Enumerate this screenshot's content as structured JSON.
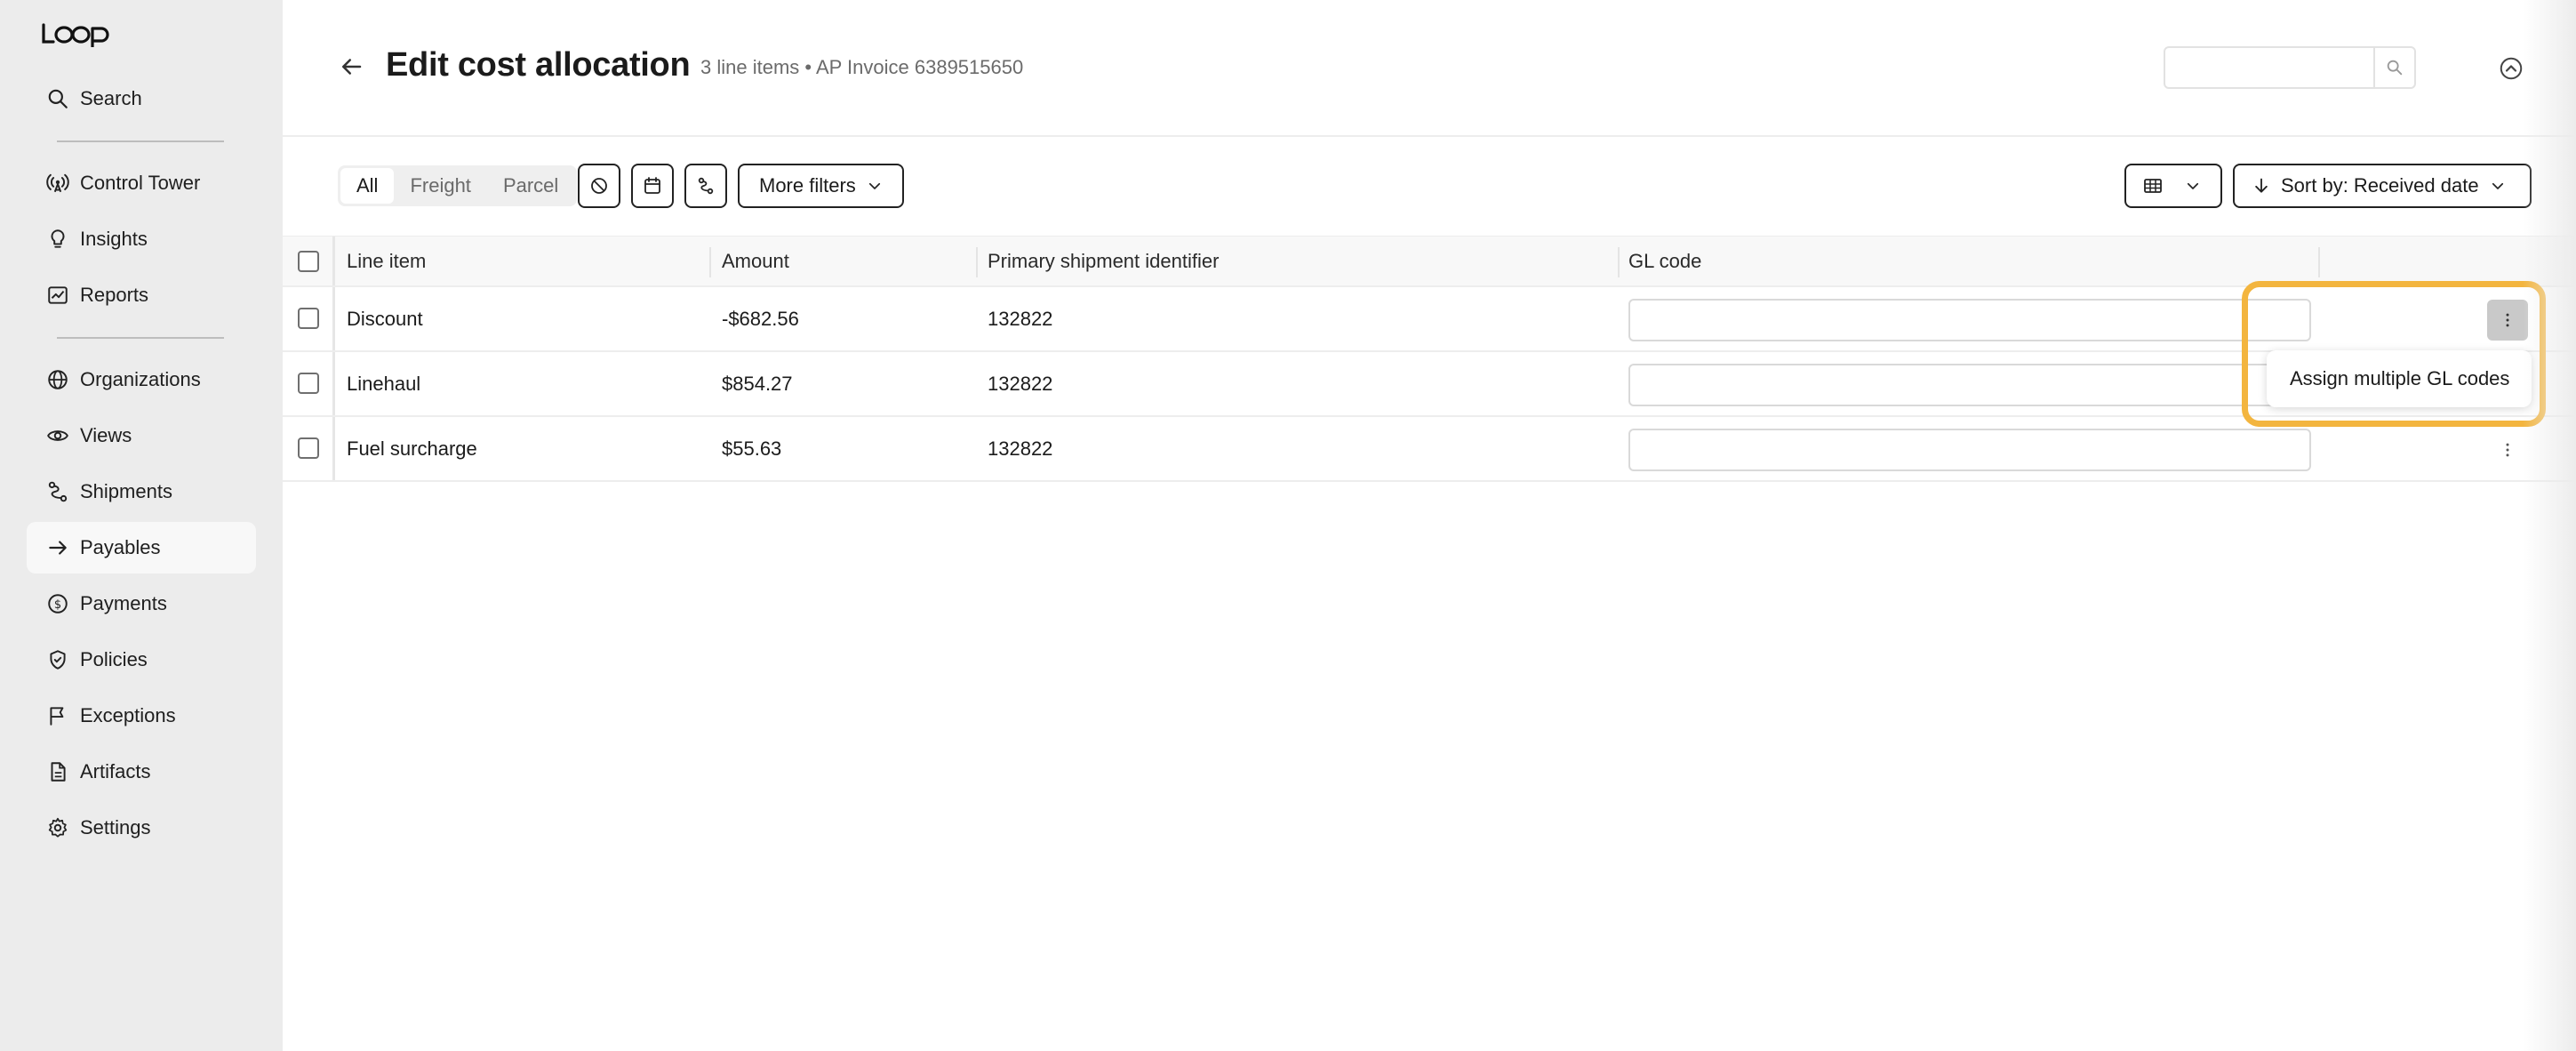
{
  "app": {
    "logo": "Loop"
  },
  "sidebar": {
    "items": [
      {
        "label": "Search",
        "icon": "search-icon"
      },
      {
        "label": "Control Tower",
        "icon": "broadcast-icon"
      },
      {
        "label": "Insights",
        "icon": "lightbulb-icon"
      },
      {
        "label": "Reports",
        "icon": "chart-icon"
      },
      {
        "label": "Organizations",
        "icon": "globe-icon"
      },
      {
        "label": "Views",
        "icon": "eye-icon"
      },
      {
        "label": "Shipments",
        "icon": "route-icon"
      },
      {
        "label": "Payables",
        "icon": "arrow-right-icon",
        "active": true
      },
      {
        "label": "Payments",
        "icon": "dollar-circle-icon"
      },
      {
        "label": "Policies",
        "icon": "shield-check-icon"
      },
      {
        "label": "Exceptions",
        "icon": "flag-icon"
      },
      {
        "label": "Artifacts",
        "icon": "document-icon"
      },
      {
        "label": "Settings",
        "icon": "gear-icon"
      }
    ]
  },
  "header": {
    "title": "Edit cost allocation",
    "subtitle": "3 line items • AP Invoice 6389515650",
    "search_value": ""
  },
  "toolbar": {
    "segments": [
      "All",
      "Freight",
      "Parcel"
    ],
    "selected_segment": "All",
    "more_filters_label": "More filters",
    "sort_label": "Sort by: Received date"
  },
  "table": {
    "columns": [
      "Line item",
      "Amount",
      "Primary shipment identifier",
      "GL code"
    ],
    "rows": [
      {
        "line_item": "Discount",
        "amount": "-$682.56",
        "shipment_id": "132822",
        "gl_code": ""
      },
      {
        "line_item": "Linehaul",
        "amount": "$854.27",
        "shipment_id": "132822",
        "gl_code": ""
      },
      {
        "line_item": "Fuel surcharge",
        "amount": "$55.63",
        "shipment_id": "132822",
        "gl_code": ""
      }
    ]
  },
  "row_menu": {
    "item": "Assign multiple GL codes"
  },
  "colors": {
    "highlight": "#f3b53f",
    "sidebar_bg": "#ececec"
  }
}
